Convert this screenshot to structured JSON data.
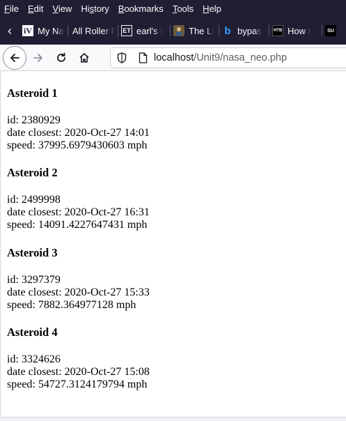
{
  "menubar": {
    "items": [
      {
        "acc": "F",
        "rest": "ile"
      },
      {
        "acc": "E",
        "rest": "dit"
      },
      {
        "acc": "V",
        "rest": "iew"
      },
      {
        "pre": "Hi",
        "acc": "s",
        "rest": "tory"
      },
      {
        "acc": "B",
        "rest": "ookmarks"
      },
      {
        "acc": "T",
        "rest": "ools"
      },
      {
        "acc": "H",
        "rest": "elp"
      }
    ]
  },
  "bookmarks": [
    {
      "icon": "iV",
      "label": "My Na"
    },
    {
      "icon": "",
      "label": "All Roller R"
    },
    {
      "icon": "ET",
      "label": "earl's l"
    },
    {
      "icon": "",
      "label": "The Li"
    },
    {
      "icon": "b",
      "label": "bypas"
    },
    {
      "icon": "HTB",
      "label": "How t"
    },
    {
      "icon": "SU",
      "label": ""
    }
  ],
  "address": {
    "host": "localhost",
    "path": "/Unit9/nasa_neo.php"
  },
  "asteroids": [
    {
      "title": "Asteroid 1",
      "id": "id: 2380929",
      "date": "date closest: 2020-Oct-27 14:01",
      "speed": "speed: 37995.6979430603 mph"
    },
    {
      "title": "Asteroid 2",
      "id": "id: 2499998",
      "date": "date closest: 2020-Oct-27 16:31",
      "speed": "speed: 14091.4227647431 mph"
    },
    {
      "title": "Asteroid 3",
      "id": "id: 3297379",
      "date": "date closest: 2020-Oct-27 15:33",
      "speed": "speed: 7882.364977128 mph"
    },
    {
      "title": "Asteroid 4",
      "id": "id: 3324626",
      "date": "date closest: 2020-Oct-27 15:08",
      "speed": "speed: 54727.3124179794 mph"
    }
  ]
}
